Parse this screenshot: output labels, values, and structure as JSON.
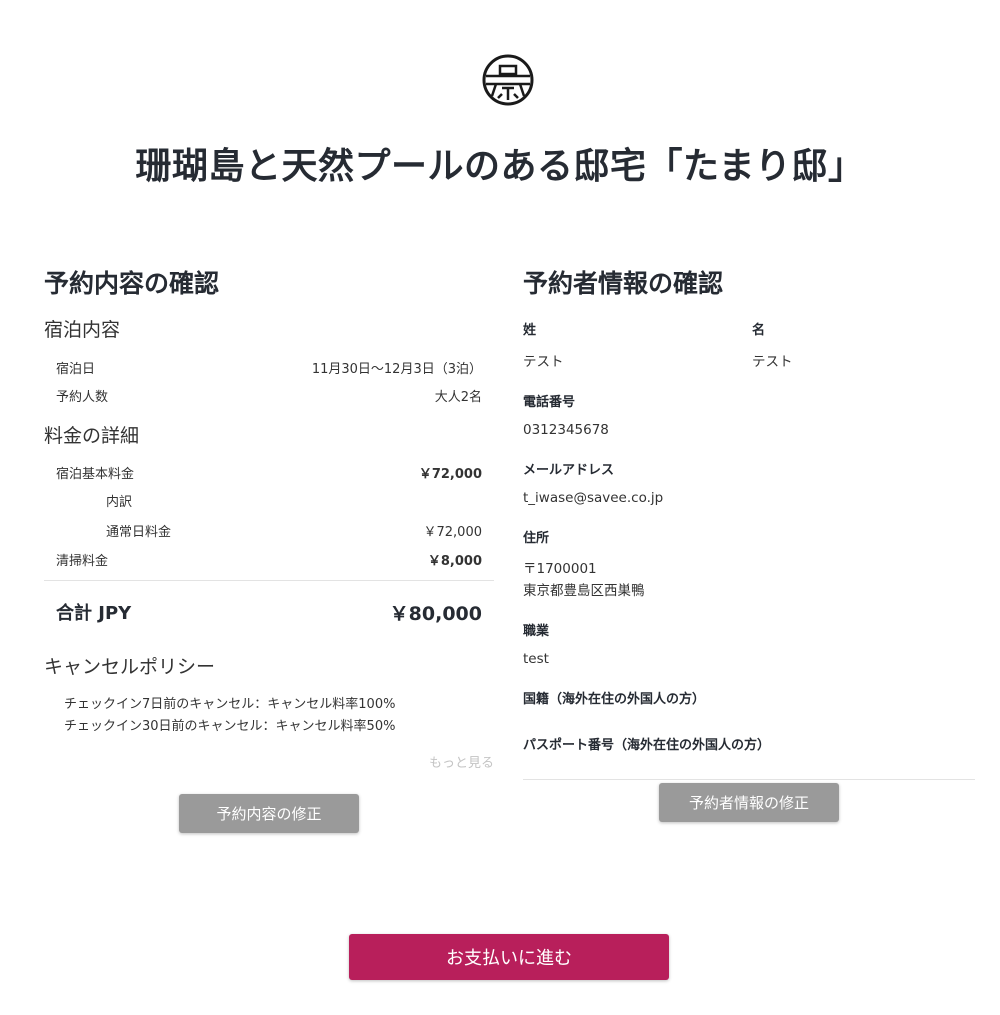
{
  "header": {
    "title": "珊瑚島と天然プールのある邸宅「たまり邸」",
    "logo_icon": "property-seal-logo-icon"
  },
  "reservation": {
    "section_title": "予約内容の確認",
    "stay": {
      "title": "宿泊内容",
      "date_label": "宿泊日",
      "date_value": "11月30日～12月3日（3泊）",
      "guests_label": "予約人数",
      "guests_value": "大人2名"
    },
    "fees": {
      "title": "料金の詳細",
      "base_label": "宿泊基本料金",
      "base_value": "￥72,000",
      "breakdown_label": "内訳",
      "weekday_label": "通常日料金",
      "weekday_value": "￥72,000",
      "cleaning_label": "清掃料金",
      "cleaning_value": "￥8,000"
    },
    "total": {
      "label": "合計 JPY",
      "value": "￥80,000"
    },
    "cancel_policy": {
      "title": "キャンセルポリシー",
      "lines": [
        "チェックイン7日前のキャンセル：キャンセル料率100%",
        "チェックイン30日前のキャンセル：キャンセル料率50%"
      ],
      "more_label": "もっと見る"
    },
    "edit_button_label": "予約内容の修正"
  },
  "guest": {
    "section_title": "予約者情報の確認",
    "last_name_label": "姓",
    "last_name_value": "テスト",
    "first_name_label": "名",
    "first_name_value": "テスト",
    "phone_label": "電話番号",
    "phone_value": "0312345678",
    "email_label": "メールアドレス",
    "email_value": "t_iwase@savee.co.jp",
    "address_label": "住所",
    "postal_value": "〒1700001",
    "address_value": "東京都豊島区西巣鴨",
    "occupation_label": "職業",
    "occupation_value": "test",
    "nationality_label": "国籍（海外在住の外国人の方）",
    "passport_label": "パスポート番号（海外在住の外国人の方）",
    "edit_button_label": "予約者情報の修正"
  },
  "footer": {
    "pay_button_label": "お支払いに進む"
  },
  "colors": {
    "primary": "#b81f5b",
    "secondary_button": "#9a9a9a",
    "heading": "#262b33",
    "muted_link": "#c4c4c4"
  }
}
